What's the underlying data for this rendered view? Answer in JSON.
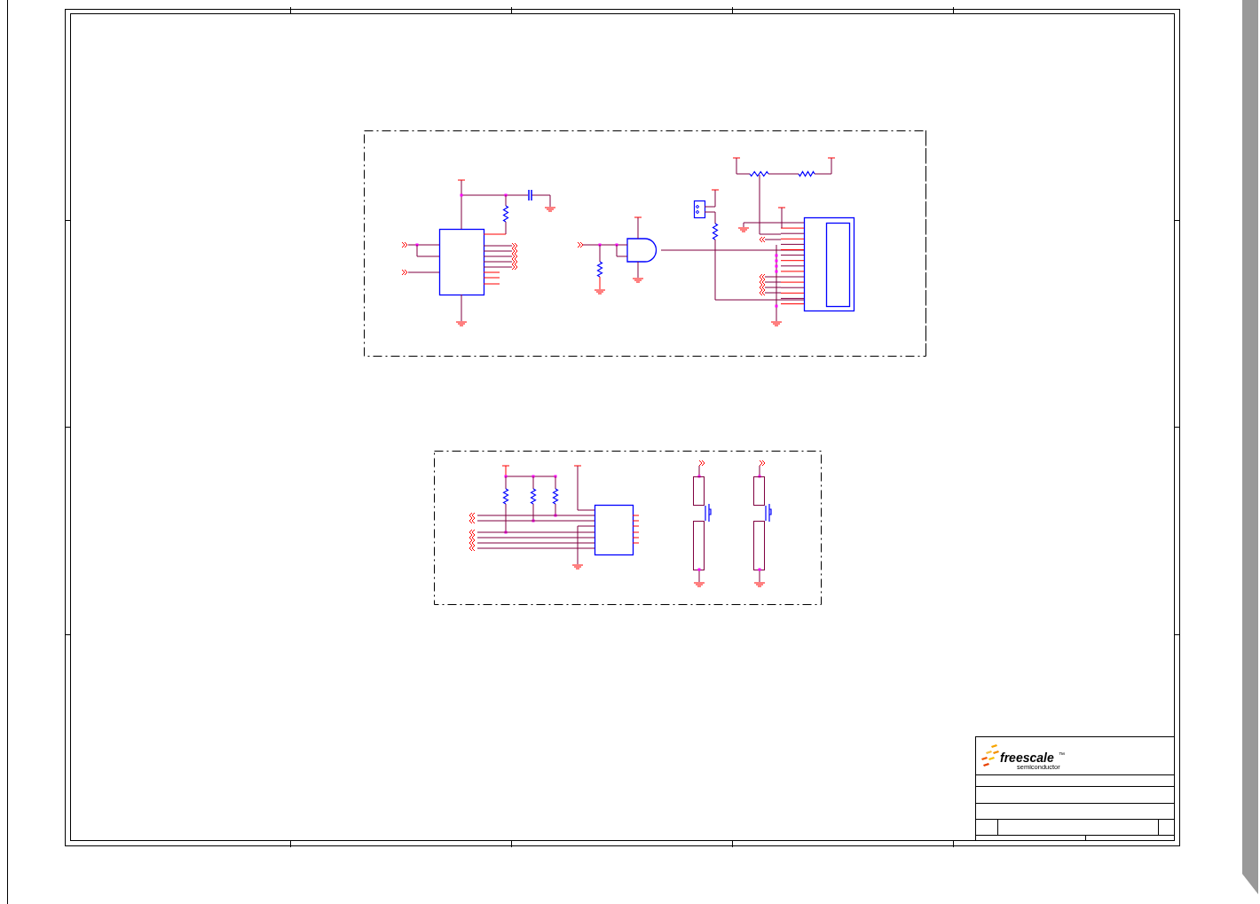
{
  "title_block": {
    "logo_text": "freescale",
    "trademark": "™",
    "tagline": "semiconductor"
  }
}
